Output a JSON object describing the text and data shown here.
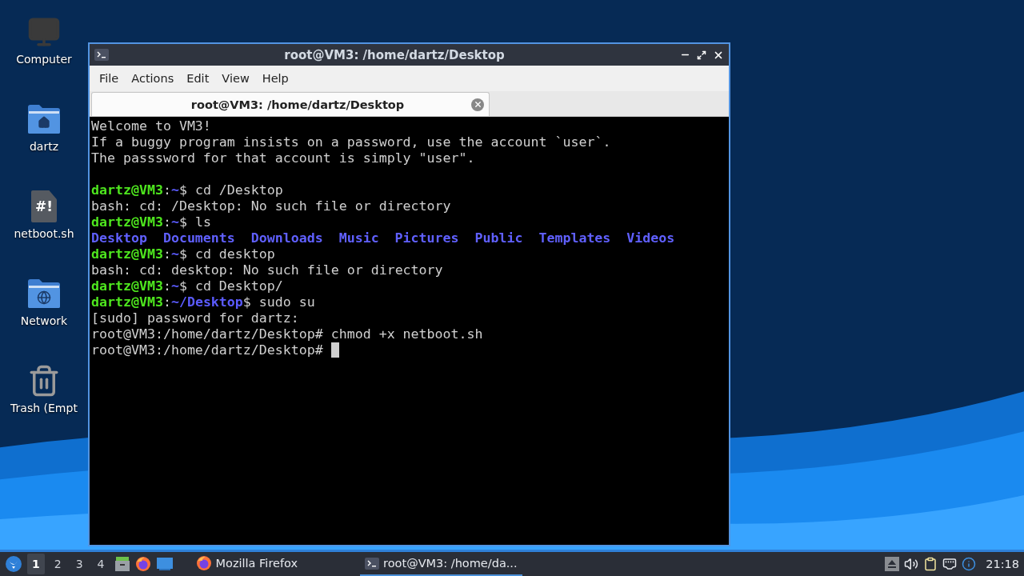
{
  "desktop_icons": [
    {
      "kind": "computer",
      "label": "Computer"
    },
    {
      "kind": "home",
      "label": "dartz"
    },
    {
      "kind": "script",
      "glyph": "#!",
      "label": "netboot.sh"
    },
    {
      "kind": "network",
      "label": "Network"
    },
    {
      "kind": "trash",
      "label": "Trash (Empt"
    }
  ],
  "window": {
    "title": "root@VM3: /home/dartz/Desktop",
    "menu": [
      "File",
      "Actions",
      "Edit",
      "View",
      "Help"
    ],
    "tabs": [
      {
        "label": "root@VM3: /home/dartz/Desktop",
        "selected": true
      }
    ],
    "terminal": {
      "lines": [
        {
          "kind": "text",
          "segments": [
            {
              "kind": "plain",
              "text": "Welcome to VM3!"
            }
          ]
        },
        {
          "kind": "text",
          "segments": [
            {
              "kind": "plain",
              "text": "If a buggy program insists on a password, use the account `user`."
            }
          ]
        },
        {
          "kind": "text",
          "segments": [
            {
              "kind": "plain",
              "text": "The passsword for that account is simply \"user\"."
            }
          ]
        },
        {
          "kind": "blank"
        },
        {
          "kind": "text",
          "segments": [
            {
              "kind": "user",
              "text": "dartz@VM3"
            },
            {
              "kind": "plain",
              "text": ":"
            },
            {
              "kind": "path",
              "text": "~"
            },
            {
              "kind": "plain",
              "text": "$ cd /Desktop"
            }
          ]
        },
        {
          "kind": "text",
          "segments": [
            {
              "kind": "plain",
              "text": "bash: cd: /Desktop: No such file or directory"
            }
          ]
        },
        {
          "kind": "text",
          "segments": [
            {
              "kind": "user",
              "text": "dartz@VM3"
            },
            {
              "kind": "plain",
              "text": ":"
            },
            {
              "kind": "path",
              "text": "~"
            },
            {
              "kind": "plain",
              "text": "$ ls"
            }
          ]
        },
        {
          "kind": "text",
          "segments": [
            {
              "kind": "dir",
              "text": "Desktop"
            },
            {
              "kind": "dir",
              "text": "Documents"
            },
            {
              "kind": "dir",
              "text": "Downloads"
            },
            {
              "kind": "dir",
              "text": "Music"
            },
            {
              "kind": "dir",
              "text": "Pictures"
            },
            {
              "kind": "dir",
              "text": "Public"
            },
            {
              "kind": "dir",
              "text": "Templates"
            },
            {
              "kind": "dir",
              "text": "Videos"
            }
          ]
        },
        {
          "kind": "text",
          "segments": [
            {
              "kind": "user",
              "text": "dartz@VM3"
            },
            {
              "kind": "plain",
              "text": ":"
            },
            {
              "kind": "path",
              "text": "~"
            },
            {
              "kind": "plain",
              "text": "$ cd desktop"
            }
          ]
        },
        {
          "kind": "text",
          "segments": [
            {
              "kind": "plain",
              "text": "bash: cd: desktop: No such file or directory"
            }
          ]
        },
        {
          "kind": "text",
          "segments": [
            {
              "kind": "user",
              "text": "dartz@VM3"
            },
            {
              "kind": "plain",
              "text": ":"
            },
            {
              "kind": "path",
              "text": "~"
            },
            {
              "kind": "plain",
              "text": "$ cd Desktop/"
            }
          ]
        },
        {
          "kind": "text",
          "segments": [
            {
              "kind": "user",
              "text": "dartz@VM3"
            },
            {
              "kind": "plain",
              "text": ":"
            },
            {
              "kind": "path",
              "text": "~/Desktop"
            },
            {
              "kind": "plain",
              "text": "$ sudo su"
            }
          ]
        },
        {
          "kind": "text",
          "segments": [
            {
              "kind": "plain",
              "text": "[sudo] password for dartz:"
            }
          ]
        },
        {
          "kind": "text",
          "segments": [
            {
              "kind": "plain",
              "text": "root@VM3:/home/dartz/Desktop# chmod +x netboot.sh"
            }
          ]
        },
        {
          "kind": "text",
          "cursor": true,
          "segments": [
            {
              "kind": "plain",
              "text": "root@VM3:/home/dartz/Desktop#"
            }
          ]
        }
      ]
    }
  },
  "taskbar": {
    "workspaces": [
      {
        "label": "1",
        "selected": true
      },
      {
        "label": "2",
        "selected": false
      },
      {
        "label": "3",
        "selected": false
      },
      {
        "label": "4",
        "selected": false
      }
    ],
    "launchers": [
      {
        "kind": "files"
      },
      {
        "kind": "browser"
      },
      {
        "kind": "desktop"
      }
    ],
    "tasks": [
      {
        "kind": "browser",
        "label": "Mozilla Firefox",
        "selected": false
      },
      {
        "kind": "terminal",
        "label": "root@VM3: /home/da...",
        "selected": true
      }
    ],
    "tray": [
      {
        "kind": "eject"
      },
      {
        "kind": "volume"
      },
      {
        "kind": "clipboard"
      },
      {
        "kind": "network"
      },
      {
        "kind": "notification"
      }
    ],
    "clock": "21:18"
  }
}
